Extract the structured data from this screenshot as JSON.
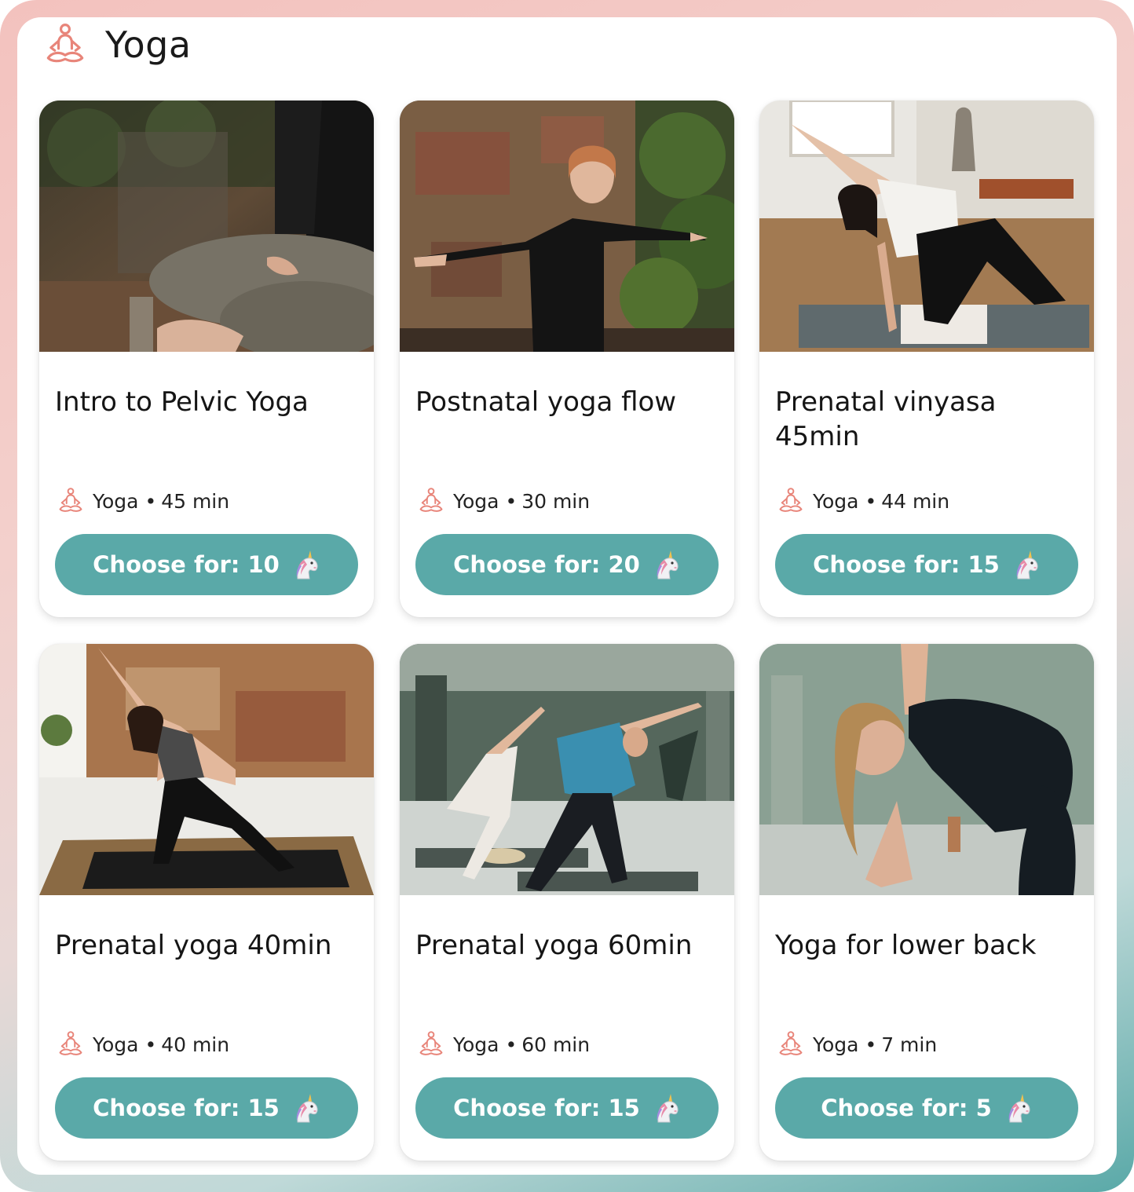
{
  "colors": {
    "accent": "#5aa9a8",
    "icon": "#e8857a",
    "frame_start": "#f3c2be",
    "frame_end": "#5aa9a8"
  },
  "header": {
    "icon": "meditation-icon",
    "title": "Yoga"
  },
  "classes": [
    {
      "title": "Intro to Pelvic Yoga",
      "category": "Yoga",
      "duration": "45 min",
      "button_label": "Choose for: 10",
      "button_icon": "unicorn-icon",
      "photo": "woman meditating cross-legged outdoors"
    },
    {
      "title": "Postnatal yoga flow",
      "category": "Yoga",
      "duration": "30 min",
      "button_label": "Choose for: 20",
      "button_icon": "unicorn-icon",
      "photo": "woman in warrior pose by brick wall"
    },
    {
      "title": "Prenatal vinyasa 45min",
      "category": "Yoga",
      "duration": "44 min",
      "button_label": "Choose for: 15",
      "button_icon": "unicorn-icon",
      "photo": "woman in side plank variation on mat"
    },
    {
      "title": "Prenatal yoga 40min",
      "category": "Yoga",
      "duration": "40 min",
      "button_label": "Choose for: 15",
      "button_icon": "unicorn-icon",
      "photo": "pregnant woman in triangle pose"
    },
    {
      "title": "Prenatal yoga 60min",
      "category": "Yoga",
      "duration": "60 min",
      "button_label": "Choose for: 15",
      "button_icon": "unicorn-icon",
      "photo": "group yoga class in triangle pose"
    },
    {
      "title": "Yoga for lower back",
      "category": "Yoga",
      "duration": "7 min",
      "button_label": "Choose for: 5",
      "button_icon": "unicorn-icon",
      "photo": "pregnant woman in side stretch"
    }
  ],
  "meta_separator": "•"
}
